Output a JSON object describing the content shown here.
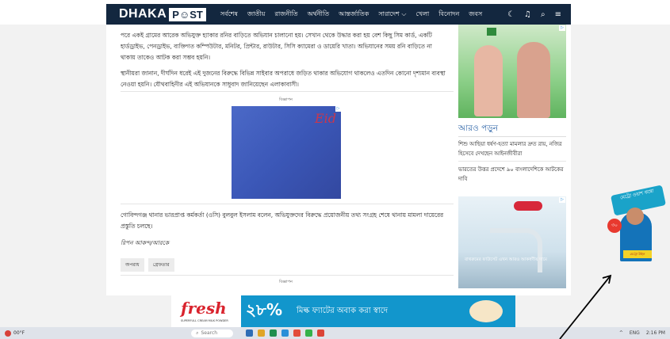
{
  "header": {
    "logo_left": "DHAKA",
    "logo_right": "P☺ST",
    "nav": [
      "সর্বশেষ",
      "জাতীয়",
      "রাজনীতি",
      "অর্থনীতি",
      "আন্তর্জাতিক",
      "সারাদেশ ⌵",
      "খেলা",
      "বিনোদন",
      "জবস"
    ],
    "icons": [
      "moon-icon",
      "bell-icon",
      "search-icon",
      "menu-icon"
    ]
  },
  "article": {
    "para1": "পরে একই গ্রামের আরেক অভিযুক্ত হ্যাকার রনির বাড়িতে অভিযান চালানো হয়। সেখান থেকে উদ্ধার করা হয় বেশ কিছু সিম কার্ড, একটি হার্ডড্রাইভ, পেনড্রাইভ, ব্যক্তিগত কম্পিউটার, মনিটর, প্রিন্টার, রাউটার, সিসি ক্যামেরা ও ডায়েরি খাতা। অভিযানের সময় রনি বাড়িতে না থাকায় তাকেও আটক করা সম্ভব হয়নি।",
    "para2": "স্থানীয়রা জানান, দীর্ঘদিন ধরেই এই দুজনের বিরুদ্ধে বিভিন্ন সাইবার অপরাধে জড়িত থাকার অভিযোগ থাকলেও এতদিন কোনো দৃশ্যমান ব্যবস্থা নেওয়া হয়নি। যৌথবাহিনীর এই অভিযানকে সাধুবাদ জানিয়েছেন এলাকাবাসী।",
    "ad_label": "বিজ্ঞাপন",
    "ad_text": "Eid",
    "para3": "গোবিন্দগঞ্জ থানার ভারপ্রাপ্ত কর্মকর্তা (ওসি) বুলবুল ইসলাম বলেন, অভিযুক্তদের বিরুদ্ধে প্রয়োজনীয় তথ্য সংগ্রহ শেষে থানায় মামলা দায়েরের প্রস্তুতি চলছে।",
    "byline": "রিপন আকন্দ/আরকে",
    "tags": [
      "অপরাধ",
      "গ্রেফতার"
    ],
    "ad_label_bottom": "বিজ্ঞাপন"
  },
  "sidebar": {
    "more_title": "আরও পড়ুন",
    "items": [
      "শিশু আছিয়া ধর্ষণ-হত্যা মামলার দ্রুত রায়, নজির হিসেবে দেখছেন আইনজীবীরা",
      "ভারতের উত্তর প্রদেশে ৯০ বাংলাদেশিকে আটকের দাবি"
    ],
    "ad2_text": "বাথরুমের ফাউসেট এখন আরও আকর্ষণীয় দামে"
  },
  "float_ad": {
    "heading": "মেট্রো ওয়াশ কম্বো",
    "circle": "৩০",
    "sign": "মেট্রো উইল"
  },
  "bottom_ad": {
    "brand": "fresh",
    "tagline": "SUPERFULL CREAM MILK POWDER",
    "big": "২৮%",
    "rest": "মিল্ক ফ্যাটের অবাক করা স্বাদে"
  },
  "taskbar": {
    "temp": "00°F",
    "search": "Search",
    "right": [
      "^",
      "ENG",
      "2:16 PM"
    ]
  }
}
